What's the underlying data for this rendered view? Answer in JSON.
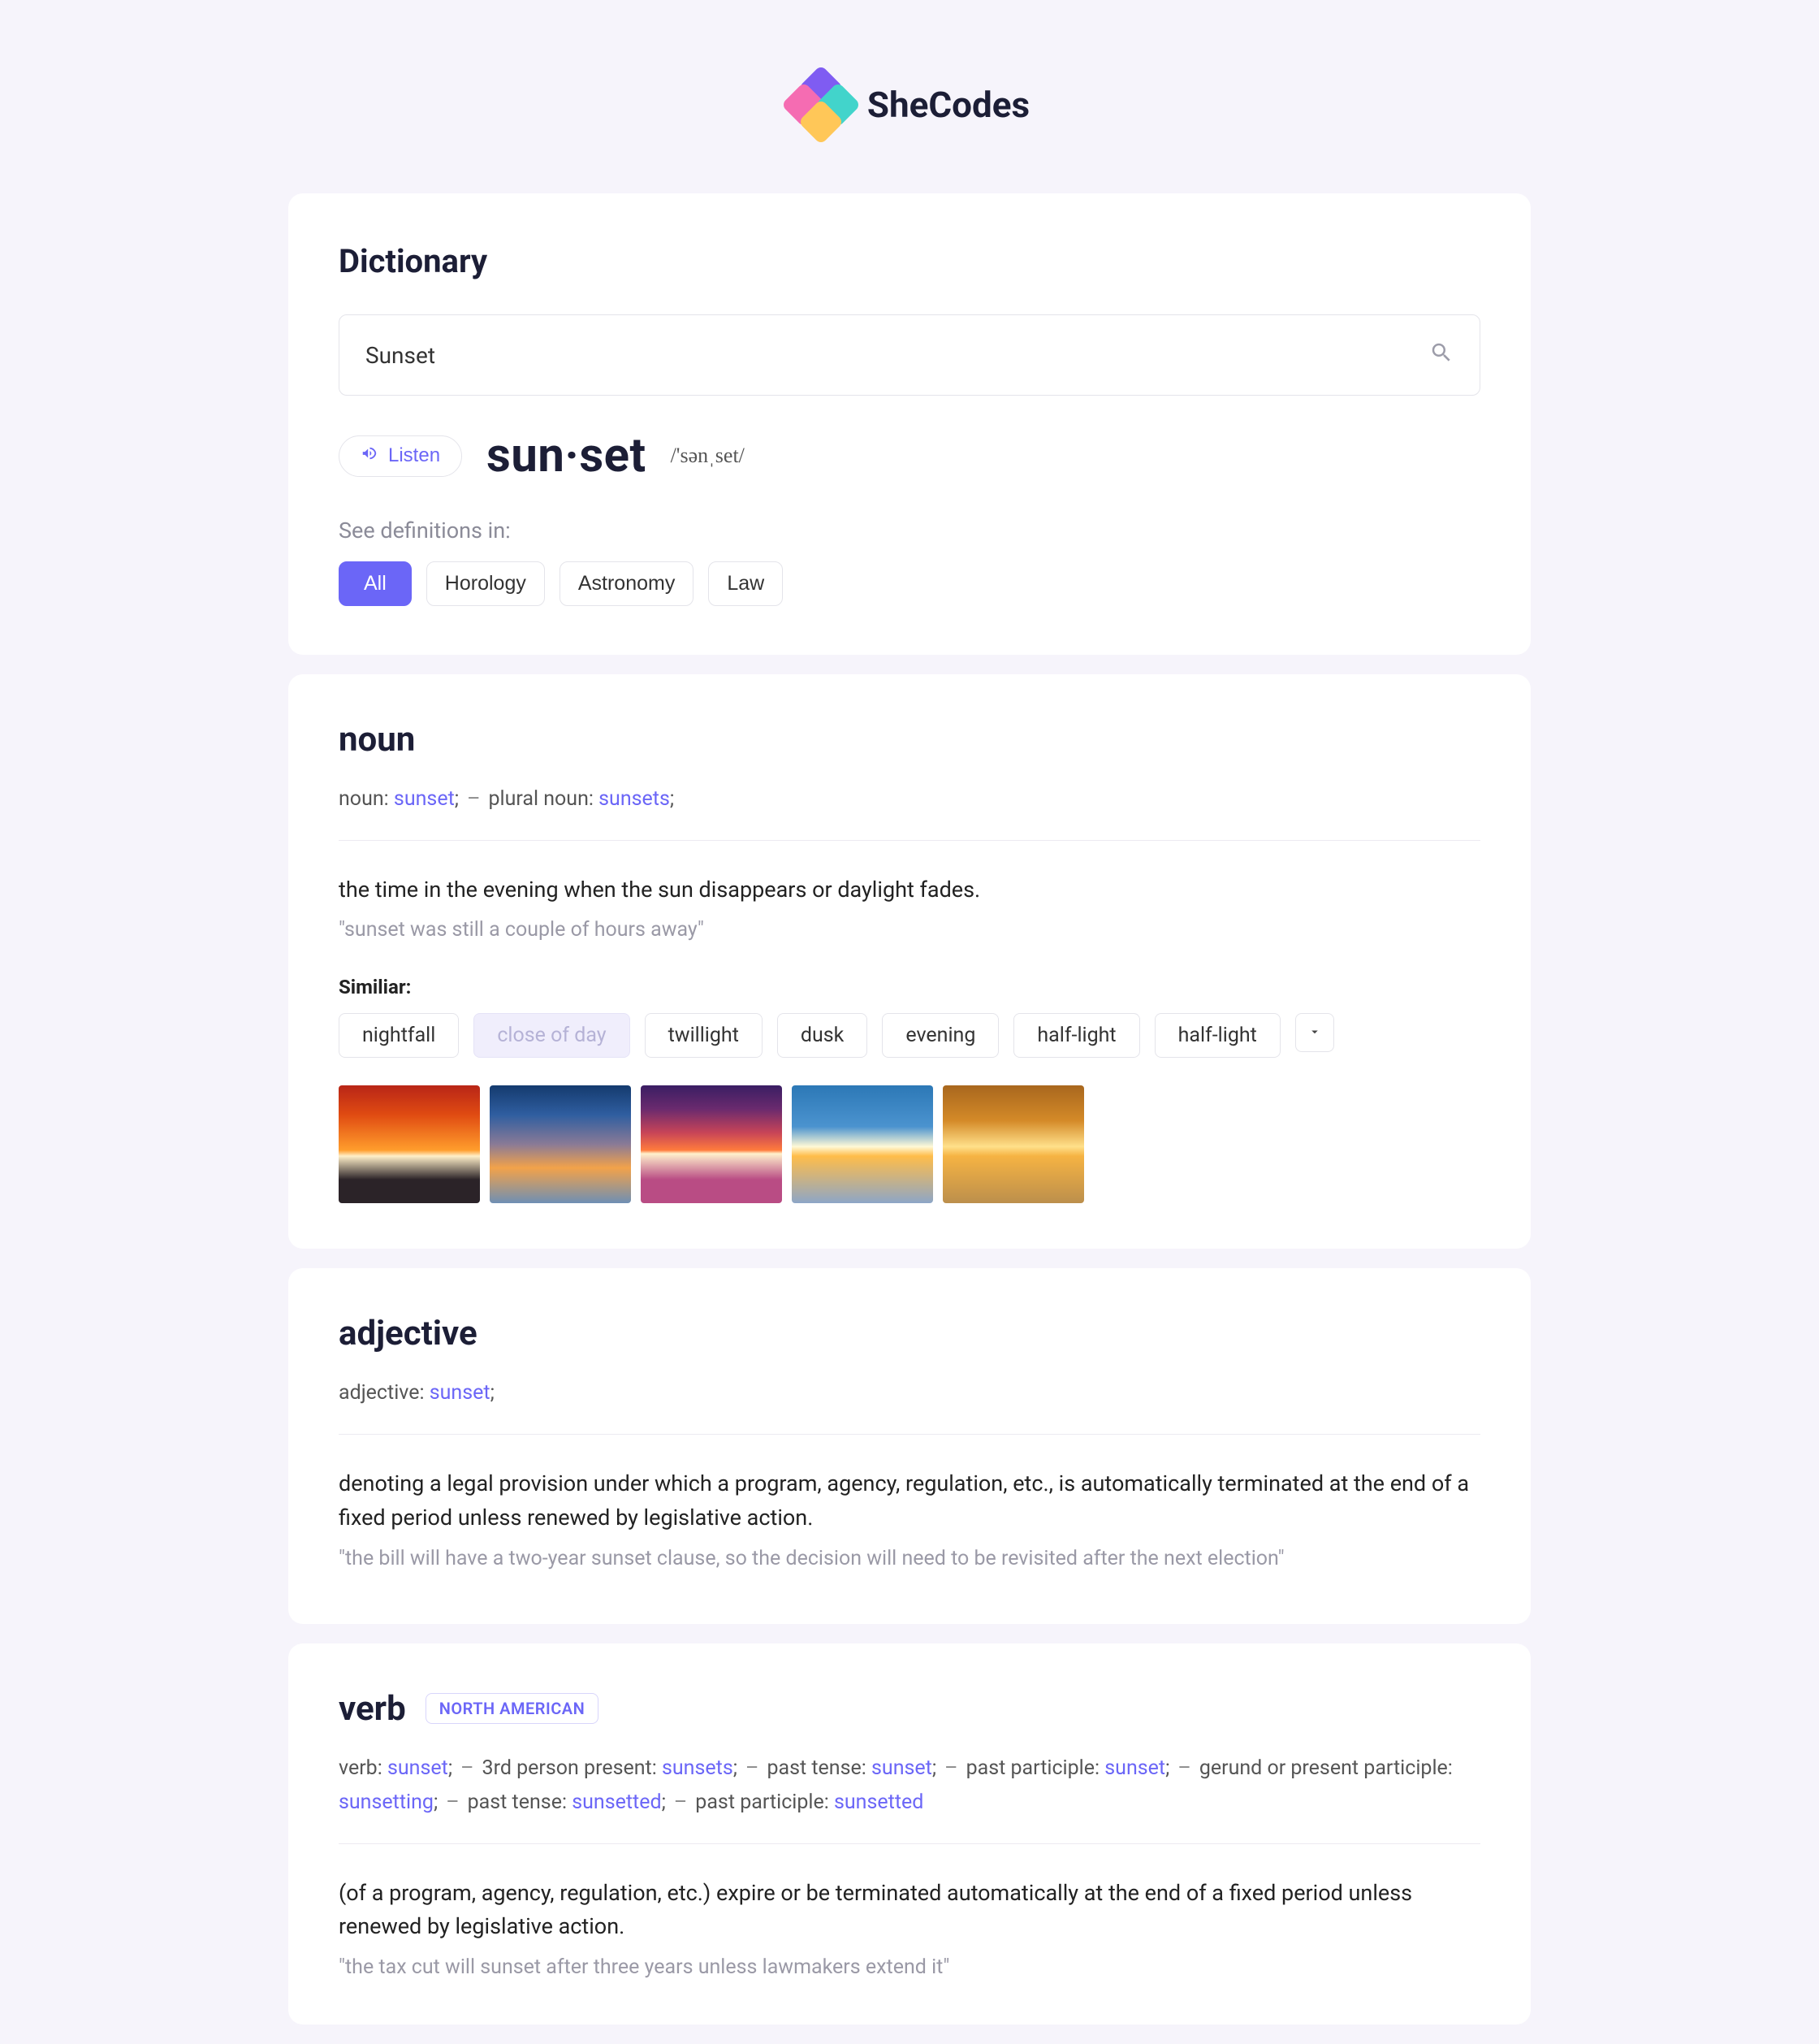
{
  "brand_name": "SheCodes",
  "header": {
    "title": "Dictionary",
    "search_value": "Sunset",
    "listen_label": "Listen",
    "headword": "sun·set",
    "phonetic": "/'sənˌset/",
    "see_definitions_label": "See definitions in:",
    "categories": [
      {
        "label": "All",
        "active": true
      },
      {
        "label": "Horology",
        "active": false
      },
      {
        "label": "Astronomy",
        "active": false
      },
      {
        "label": "Law",
        "active": false
      }
    ]
  },
  "sections": {
    "noun": {
      "heading": "noun",
      "forms": [
        {
          "label": "noun:",
          "value": "sunset",
          "suffix": ";"
        },
        {
          "label": "plural noun:",
          "value": "sunsets",
          "suffix": ";"
        }
      ],
      "definition": "the time in the evening when the sun disappears or daylight fades.",
      "example": "\"sunset was still a couple of hours away\"",
      "similar_label": "Similiar:",
      "similar": [
        {
          "label": "nightfall",
          "muted": false
        },
        {
          "label": "close of day",
          "muted": true
        },
        {
          "label": "twillight",
          "muted": false
        },
        {
          "label": "dusk",
          "muted": false
        },
        {
          "label": "evening",
          "muted": false
        },
        {
          "label": "half-light",
          "muted": false
        },
        {
          "label": "half-light",
          "muted": false
        }
      ]
    },
    "adjective": {
      "heading": "adjective",
      "forms": [
        {
          "label": "adjective:",
          "value": "sunset",
          "suffix": ";"
        }
      ],
      "definition": "denoting a legal provision under which a program, agency, regulation, etc., is automatically terminated at the end of a fixed period unless renewed by legislative action.",
      "example": "\"the bill will have a two-year sunset clause, so the decision will need to be revisited after the next election\""
    },
    "verb": {
      "heading": "verb",
      "region_tag": "NORTH AMERICAN",
      "forms": [
        {
          "label": "verb:",
          "value": "sunset",
          "suffix": ";"
        },
        {
          "label": "3rd person present:",
          "value": "sunsets",
          "suffix": ";"
        },
        {
          "label": "past tense:",
          "value": "sunset",
          "suffix": ";"
        },
        {
          "label": "past participle:",
          "value": "sunset",
          "suffix": ";"
        },
        {
          "label": "gerund or present participle:",
          "value": "sunsetting",
          "suffix": ";"
        },
        {
          "label": "past tense:",
          "value": "sunsetted",
          "suffix": ";"
        },
        {
          "label": "past participle:",
          "value": "sunsetted",
          "suffix": ""
        }
      ],
      "definition": "(of a program, agency, regulation, etc.) expire or be terminated automatically at the end of a fixed period unless renewed by legislative action.",
      "example": "\"the tax cut will sunset after three years unless lawmakers extend it\""
    }
  }
}
